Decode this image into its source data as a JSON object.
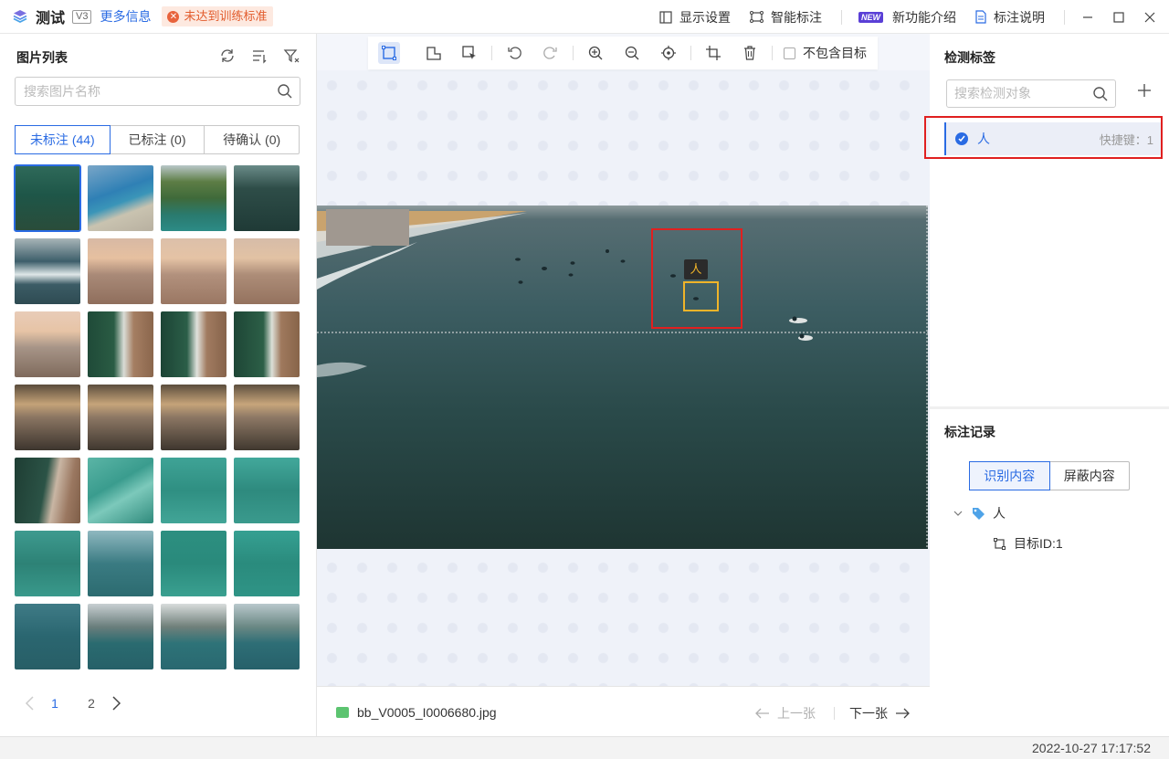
{
  "titlebar": {
    "app_name": "测试",
    "version": "V3",
    "more_info": "更多信息",
    "warning": "未达到训练标准",
    "display_settings": "显示设置",
    "smart_annotate": "智能标注",
    "new_badge": "NEW",
    "new_features": "新功能介绍",
    "annotate_help": "标注说明"
  },
  "left": {
    "title": "图片列表",
    "search_placeholder": "搜索图片名称",
    "tabs": [
      "未标注 (44)",
      "已标注 (0)",
      "待确认 (0)"
    ],
    "pages": [
      "1",
      "2"
    ]
  },
  "center": {
    "exclude_target": "不包含目标",
    "box_label": "人",
    "filename": "bb_V0005_I0006680.jpg",
    "prev": "上一张",
    "next": "下一张"
  },
  "right": {
    "title": "检测标签",
    "search_placeholder": "搜索检测对象",
    "label_name": "人",
    "label_shortcut": "快捷键：1",
    "record_title": "标注记录",
    "seg": [
      "识别内容",
      "屏蔽内容"
    ],
    "tree_label": "人",
    "tree_item": "目标ID:1"
  },
  "status": {
    "datetime": "2022-10-27 17:17:52"
  },
  "colors": {
    "accent": "#2a6be3",
    "warning": "#e25b2c",
    "highlight_box": "#e02020",
    "annotation_box": "#f0b429"
  }
}
